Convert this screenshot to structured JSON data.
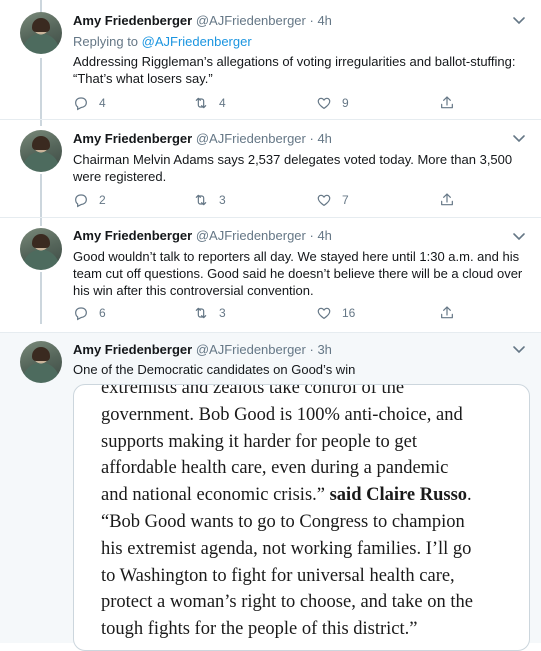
{
  "tweets": [
    {
      "name": "Amy Friedenberger",
      "handle": "@AJFriedenberger",
      "dot": "·",
      "time": "4h",
      "replying_prefix": "Replying to ",
      "replying_handle": "@AJFriedenberger",
      "text": "Addressing Riggleman’s allegations of voting irregularities and ballot-stuffing: “That’s what losers say.”",
      "replies": "4",
      "retweets": "4",
      "likes": "9"
    },
    {
      "name": "Amy Friedenberger",
      "handle": "@AJFriedenberger",
      "dot": "·",
      "time": "4h",
      "text": "Chairman Melvin Adams says 2,537 delegates voted today. More than 3,500 were registered.",
      "replies": "2",
      "retweets": "3",
      "likes": "7"
    },
    {
      "name": "Amy Friedenberger",
      "handle": "@AJFriedenberger",
      "dot": "·",
      "time": "4h",
      "text": "Good wouldn’t talk to reporters all day. We stayed here until 1:30 a.m. and his team cut off questions. Good said he doesn’t believe there will be a cloud over his win after this controversial convention.",
      "replies": "6",
      "retweets": "3",
      "likes": "16"
    },
    {
      "name": "Amy Friedenberger",
      "handle": "@AJFriedenberger",
      "dot": "·",
      "time": "3h",
      "text": "One of the Democratic candidates on Good’s win"
    }
  ],
  "quote": {
    "line1": "extremists and zealots take control of the",
    "line2": "government. Bob Good is 100% anti-choice, and",
    "line3": "supports making it harder for people to get",
    "line4": "affordable health care, even during a pandemic",
    "line5_pre": "and national economic crisis.” ",
    "line5_bold": "said Claire Russo",
    "line5_post": ".",
    "line6": "“Bob Good wants to go to Congress to champion",
    "line7": "his extremist agenda, not working families. I’ll go",
    "line8": "to Washington to fight for universal health care,",
    "line9": "protect a woman’s right to choose, and take on the",
    "line10": "tough fights for the people of this district.”"
  },
  "icons": {
    "reply": "reply-icon",
    "retweet": "retweet-icon",
    "like": "heart-icon",
    "share": "share-icon",
    "more": "chevron-down-icon"
  },
  "colors": {
    "link": "#1b95e0",
    "secondary": "#657786",
    "thread_line": "#ccd6dd",
    "highlight_bg": "#f5f8fa"
  }
}
